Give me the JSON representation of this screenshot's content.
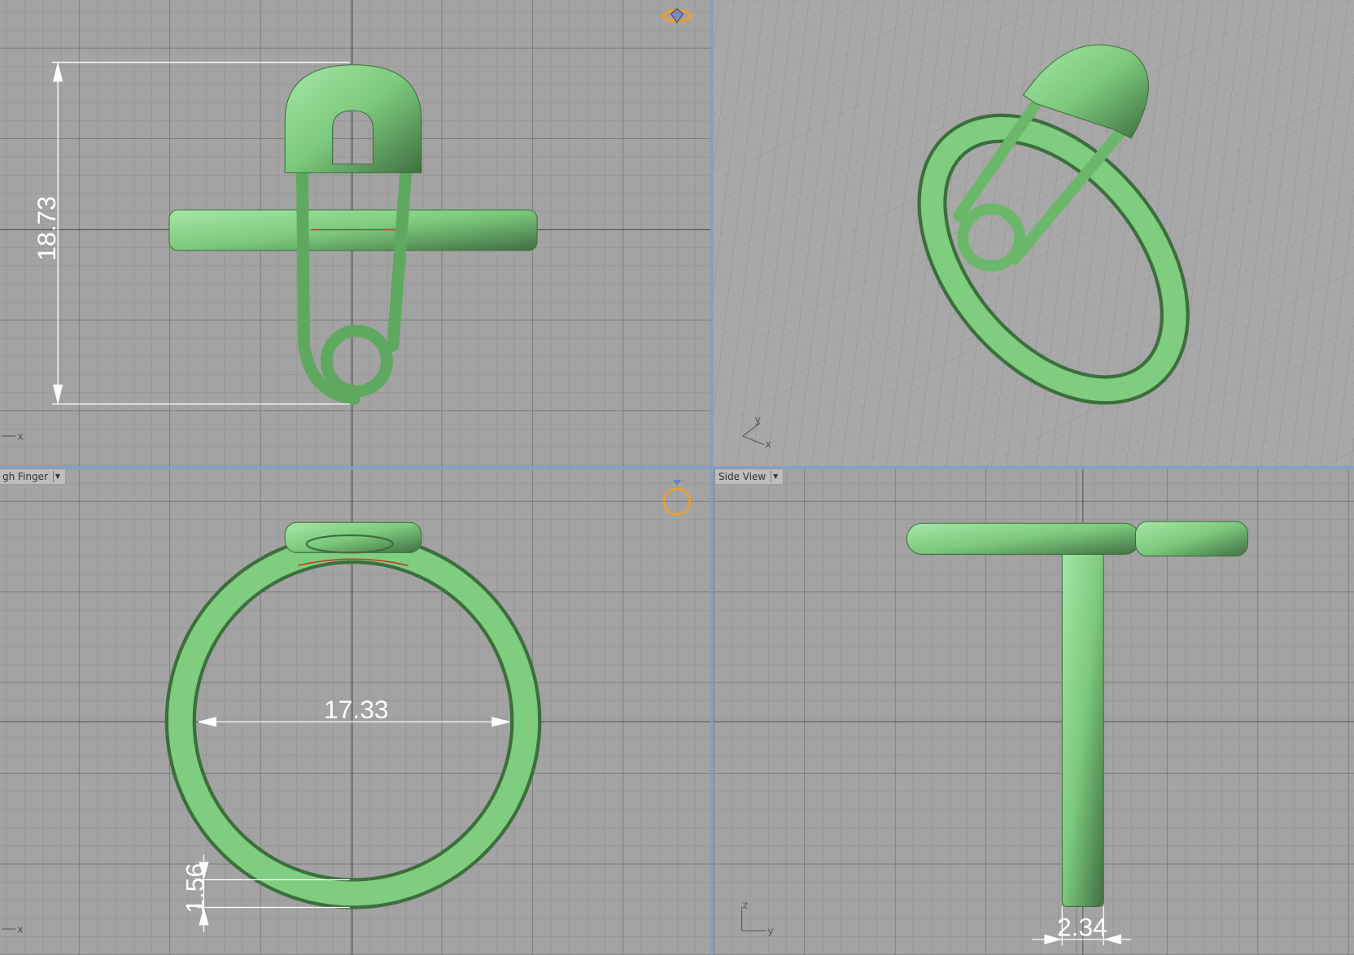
{
  "viewports": {
    "top": {
      "dimension": "18.73",
      "axis_x": "x"
    },
    "perspective": {
      "axis_x": "x",
      "axis_y": "y"
    },
    "front": {
      "label": "gh Finger",
      "dimension_diameter": "17.33",
      "dimension_thickness": "1.56",
      "axis_x": "x"
    },
    "side": {
      "label": "Side View",
      "dimension_width": "2.34",
      "axis_y": "y",
      "axis_z": "z"
    }
  },
  "colors": {
    "model": "#7fcd7f",
    "model_edge": "#3d6e3d",
    "grid_bg": "#a3a3a3",
    "divider": "#7f9fd0"
  }
}
